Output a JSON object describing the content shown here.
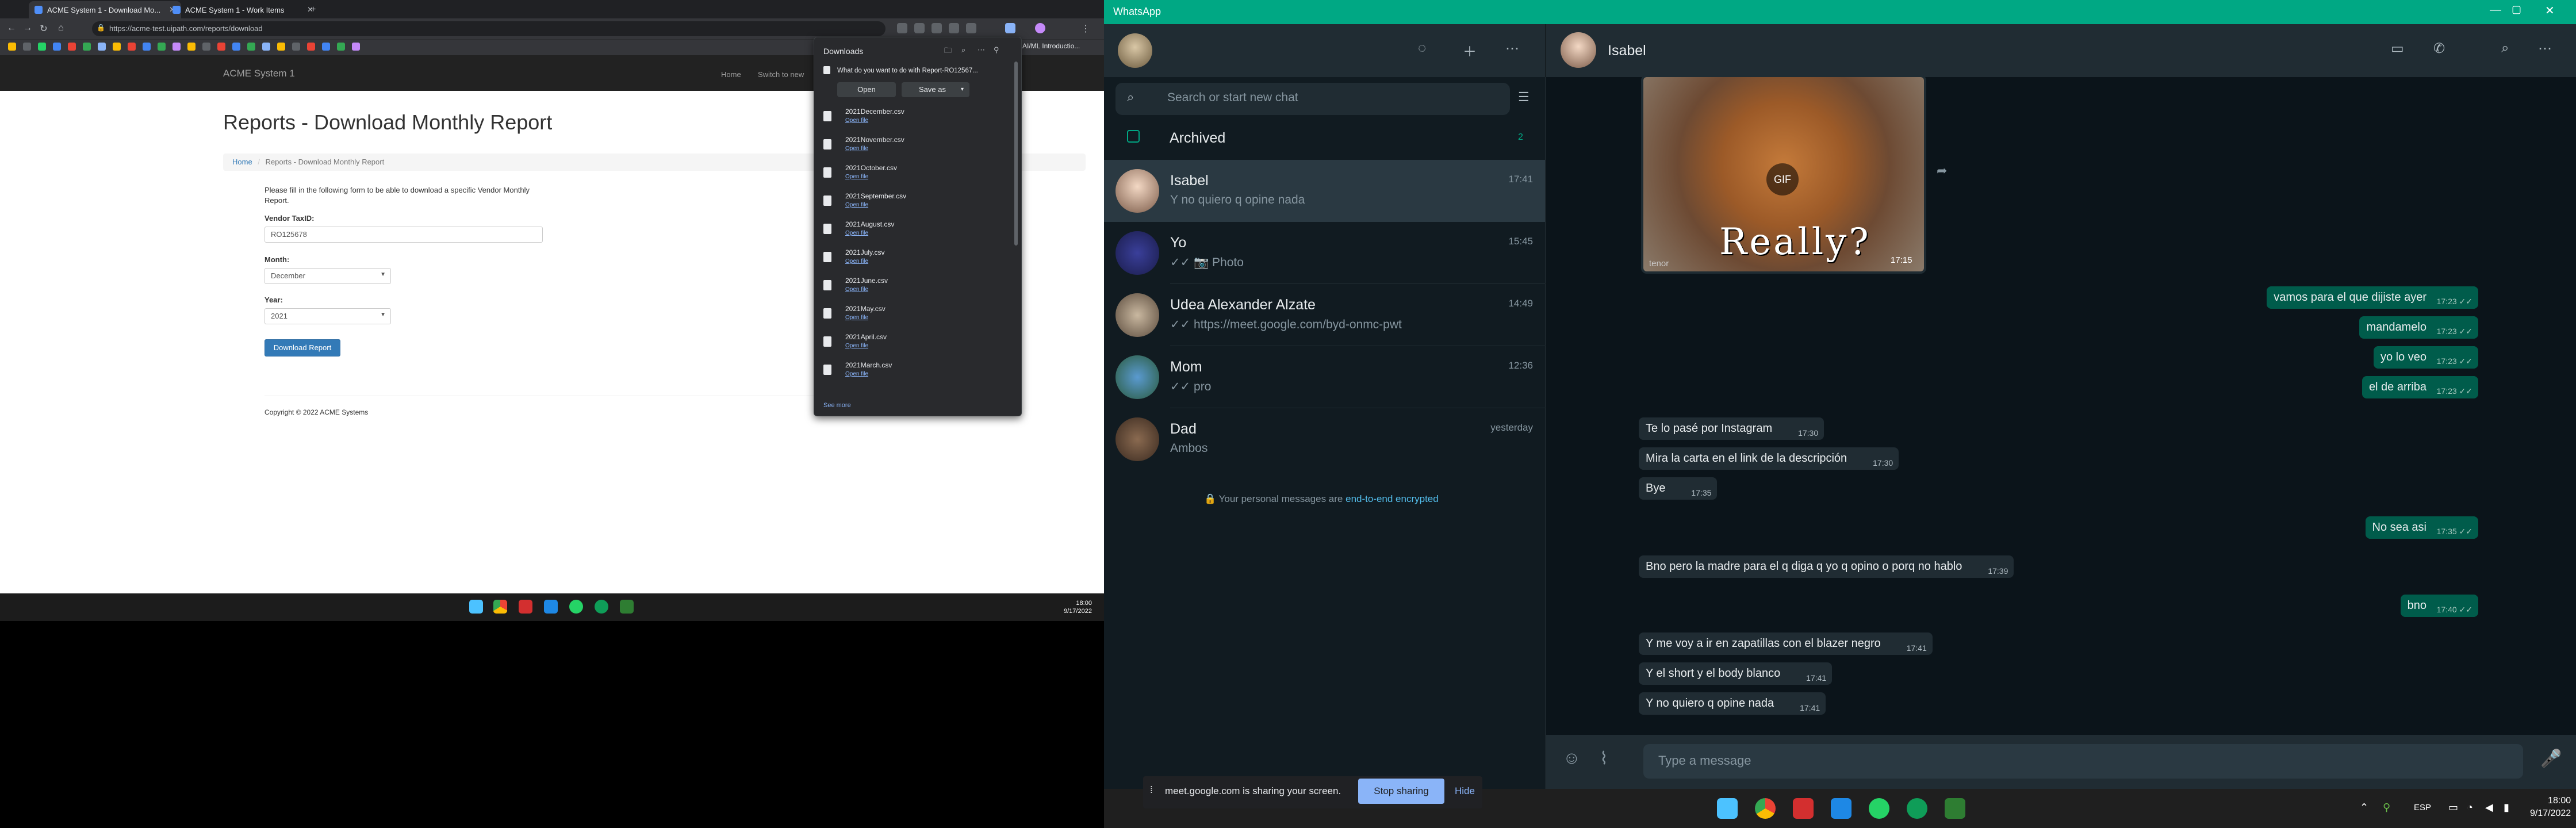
{
  "browser": {
    "tabs": [
      {
        "title": "ACME System 1 - Download Mo..."
      },
      {
        "title": "ACME System 1 - Work Items"
      }
    ],
    "url": "https://acme-test.uipath.com/reports/download",
    "ext_text": "AI/ML Introductio..."
  },
  "acme": {
    "brand": "ACME System 1",
    "nav": [
      "Home",
      "Switch to new"
    ],
    "title": "Reports - Download Monthly Report",
    "breadcrumb_home": "Home",
    "breadcrumb_current": "Reports - Download Monthly Report",
    "intro": "Please fill in the following form to be able to download a specific Vendor Monthly Report.",
    "vendor_label": "Vendor TaxID:",
    "vendor_value": "RO125678",
    "month_label": "Month:",
    "month_value": "December",
    "year_label": "Year:",
    "year_value": "2021",
    "download_button": "Download Report",
    "copyright": "Copyright © 2022 ACME Systems"
  },
  "downloads": {
    "title": "Downloads",
    "question": "What do you want to do with Report-RO12567...",
    "open_button": "Open",
    "save_button": "Save as",
    "open_file_label": "Open file",
    "items": [
      "2021December.csv",
      "2021November.csv",
      "2021October.csv",
      "2021September.csv",
      "2021August.csv",
      "2021July.csv",
      "2021June.csv",
      "2021May.csv",
      "2021April.csv",
      "2021March.csv"
    ],
    "see_more": "See more"
  },
  "left_clock": {
    "time": "18:00",
    "date": "9/17/2022"
  },
  "whatsapp": {
    "window_title": "WhatsApp",
    "search_placeholder": "Search or start new chat",
    "archived_label": "Archived",
    "archived_count": "2",
    "chats": [
      {
        "name": "Isabel",
        "time": "17:41",
        "preview": "Y no quiero q opine nada",
        "selected": true
      },
      {
        "name": "Yo",
        "time": "15:45",
        "preview": "✓✓ 📷 Photo",
        "selected": false
      },
      {
        "name": "Udea Alexander Alzate",
        "time": "14:49",
        "preview": "✓✓ https://meet.google.com/byd-onmc-pwt",
        "selected": false
      },
      {
        "name": "Mom",
        "time": "12:36",
        "preview": "✓✓ pro",
        "selected": false
      },
      {
        "name": "Dad",
        "time": "yesterday",
        "preview": "Ambos",
        "selected": false
      }
    ],
    "e2e_text": "Your personal messages are",
    "e2e_link": "end-to-end encrypted",
    "active_chat_name": "Isabel",
    "gif": {
      "badge": "GIF",
      "caption": "Really?",
      "time": "17:15",
      "brand": "tenor"
    },
    "messages": [
      {
        "dir": "out",
        "text": "vamos para el que dijiste ayer",
        "time": "17:23 ✓✓"
      },
      {
        "dir": "out",
        "text": "mandamelo",
        "time": "17:23 ✓✓"
      },
      {
        "dir": "out",
        "text": "yo lo veo",
        "time": "17:23 ✓✓"
      },
      {
        "dir": "out",
        "text": "el de arriba",
        "time": "17:23 ✓✓"
      },
      {
        "dir": "in",
        "text": "Te lo pasé por Instagram",
        "time": "17:30"
      },
      {
        "dir": "in",
        "text": "Mira la carta en el link de la descripción",
        "time": "17:30"
      },
      {
        "dir": "in",
        "text": "Bye",
        "time": "17:35"
      },
      {
        "dir": "out",
        "text": "No sea asi",
        "time": "17:35 ✓✓"
      },
      {
        "dir": "in",
        "text": "Bno pero la madre para el q diga q yo q opino o porq no hablo",
        "time": "17:39"
      },
      {
        "dir": "out",
        "text": "bno",
        "time": "17:40 ✓✓"
      },
      {
        "dir": "in",
        "text": "Y me voy a ir en zapatillas con el blazer negro",
        "time": "17:41"
      },
      {
        "dir": "in",
        "text": "Y el short y el body blanco",
        "time": "17:41"
      },
      {
        "dir": "in",
        "text": "Y no quiero q opine nada",
        "time": "17:41"
      }
    ],
    "composer_placeholder": "Type a message"
  },
  "share_bar": {
    "text": "meet.google.com is sharing your screen.",
    "stop": "Stop sharing",
    "hide": "Hide"
  },
  "right_clock": {
    "time": "18:00",
    "date": "9/17/2022",
    "lang": "ESP"
  },
  "colors": {
    "wa_accent": "#00a884",
    "out_bubble": "#005c4b",
    "in_bubble": "#202c33",
    "acme_button": "#337ab7"
  }
}
